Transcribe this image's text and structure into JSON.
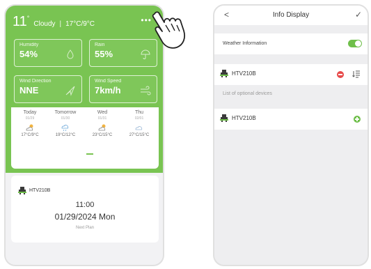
{
  "left_screen": {
    "header": {
      "temperature": "11",
      "degree": "°",
      "condition": "Cloudy",
      "separator": "|",
      "range": "17°C/9°C",
      "more_icon": "more-dots-icon"
    },
    "tiles": [
      {
        "label": "Humidity",
        "value": "54%",
        "icon": "droplet-icon"
      },
      {
        "label": "Rain",
        "value": "55%",
        "icon": "umbrella-icon"
      },
      {
        "label": "Wind Direction",
        "value": "NNE",
        "icon": "direction-arrow-icon"
      },
      {
        "label": "Wind Speed",
        "value": "7km/h",
        "icon": "wind-icon"
      }
    ],
    "forecast": [
      {
        "day": "Today",
        "date": "01/29",
        "icon": "partly-cloudy-icon",
        "range": "17°C/9°C"
      },
      {
        "day": "Tomorrow",
        "date": "01/30",
        "icon": "rain-icon",
        "range": "19°C/12°C"
      },
      {
        "day": "Wed",
        "date": "01/31",
        "icon": "partly-cloudy-icon",
        "range": "23°C/15°C"
      },
      {
        "day": "Thu",
        "date": "02/01",
        "icon": "cloudy-icon",
        "range": "27°C/15°C"
      }
    ],
    "plan": {
      "device": "HTV210B",
      "time": "11:00",
      "date": "01/29/2024 Mon",
      "next_label": "Next Plan"
    }
  },
  "right_screen": {
    "nav": {
      "back": "<",
      "title": "Info Display",
      "confirm": "✓"
    },
    "weather_info_label": "Weather Information",
    "weather_info_enabled": true,
    "selected_device": "HTV210B",
    "optional_label": "List of optional devices",
    "optional_device": "HTV210B"
  },
  "colors": {
    "accent_green": "#79c452",
    "remove_red": "#e74a4a",
    "toggle_green": "#6fbf4a"
  }
}
